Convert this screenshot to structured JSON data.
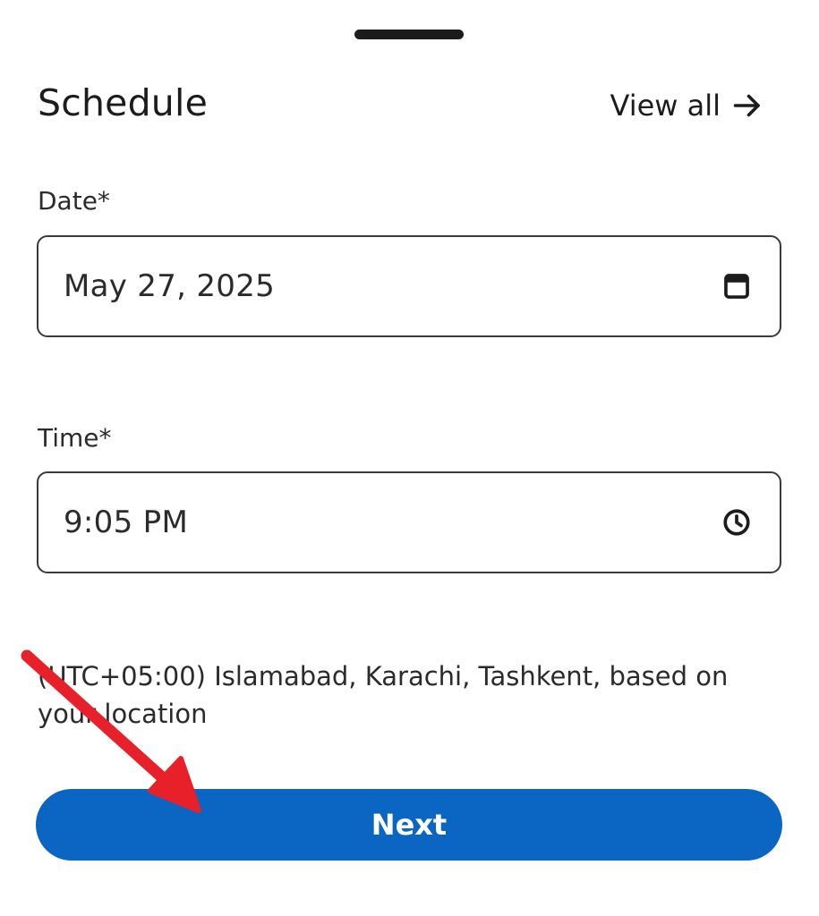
{
  "sheet": {
    "title": "Schedule",
    "view_all_label": "View all"
  },
  "date_field": {
    "label": "Date*",
    "value": "May 27, 2025",
    "icon": "calendar-icon"
  },
  "time_field": {
    "label": "Time*",
    "value": "9:05 PM",
    "icon": "clock-icon"
  },
  "timezone_note": "(UTC+05:00) Islamabad, Karachi, Tashkent, based on your location",
  "next_button": {
    "label": "Next"
  },
  "colors": {
    "accent": "#0a66c2",
    "annotation_arrow": "#e8202a",
    "text": "#1c1c1c",
    "border": "#3a3a3a"
  }
}
